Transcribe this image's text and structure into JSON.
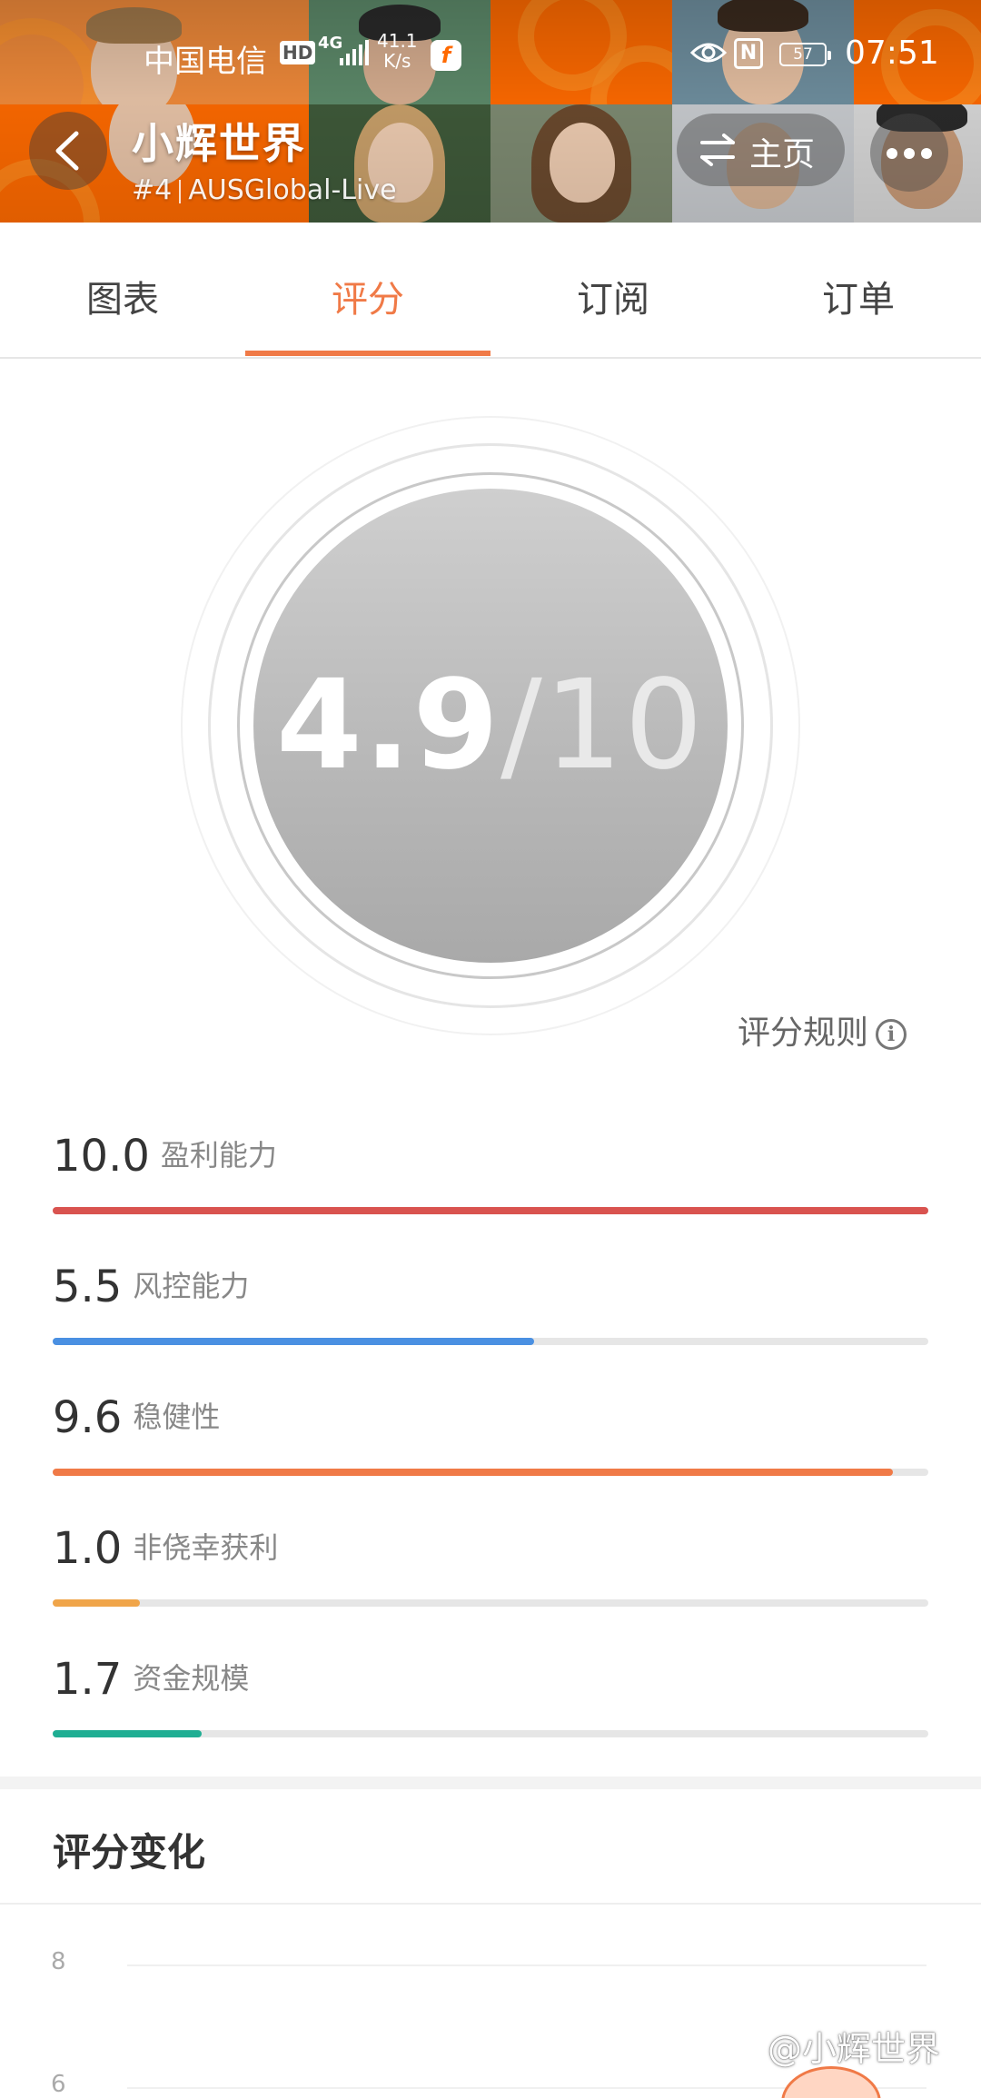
{
  "status_bar": {
    "carrier": "中国电信",
    "hd": "HD",
    "network": "4G",
    "speed_value": "41.1",
    "speed_unit": "K/s",
    "battery": "57",
    "time": "07:51"
  },
  "header": {
    "title": "小辉世界",
    "rank": "#4",
    "server": "AUSGlobal-Live",
    "home_label": "主页"
  },
  "tabs": [
    {
      "label": "图表",
      "active": false
    },
    {
      "label": "评分",
      "active": true
    },
    {
      "label": "订阅",
      "active": false
    },
    {
      "label": "订单",
      "active": false
    }
  ],
  "score": {
    "value": "4.9",
    "total": "/10"
  },
  "rule_link": "评分规则",
  "metrics": [
    {
      "value": "10.0",
      "name": "盈利能力",
      "fraction": 1.0,
      "color": "#d9534f"
    },
    {
      "value": "5.5",
      "name": "风控能力",
      "fraction": 0.55,
      "color": "#4a90e2"
    },
    {
      "value": "9.6",
      "name": "稳健性",
      "fraction": 0.96,
      "color": "#f07a47"
    },
    {
      "value": "1.0",
      "name": "非侥幸获利",
      "fraction": 0.1,
      "color": "#f0a54a"
    },
    {
      "value": "1.7",
      "name": "资金规模",
      "fraction": 0.17,
      "color": "#1fae93"
    }
  ],
  "score_change": {
    "title": "评分变化",
    "y_ticks": [
      "8",
      "6"
    ]
  },
  "watermark": "@小辉世界",
  "colors": {
    "accent": "#f07a47",
    "header_orange": "#ff6a00"
  }
}
